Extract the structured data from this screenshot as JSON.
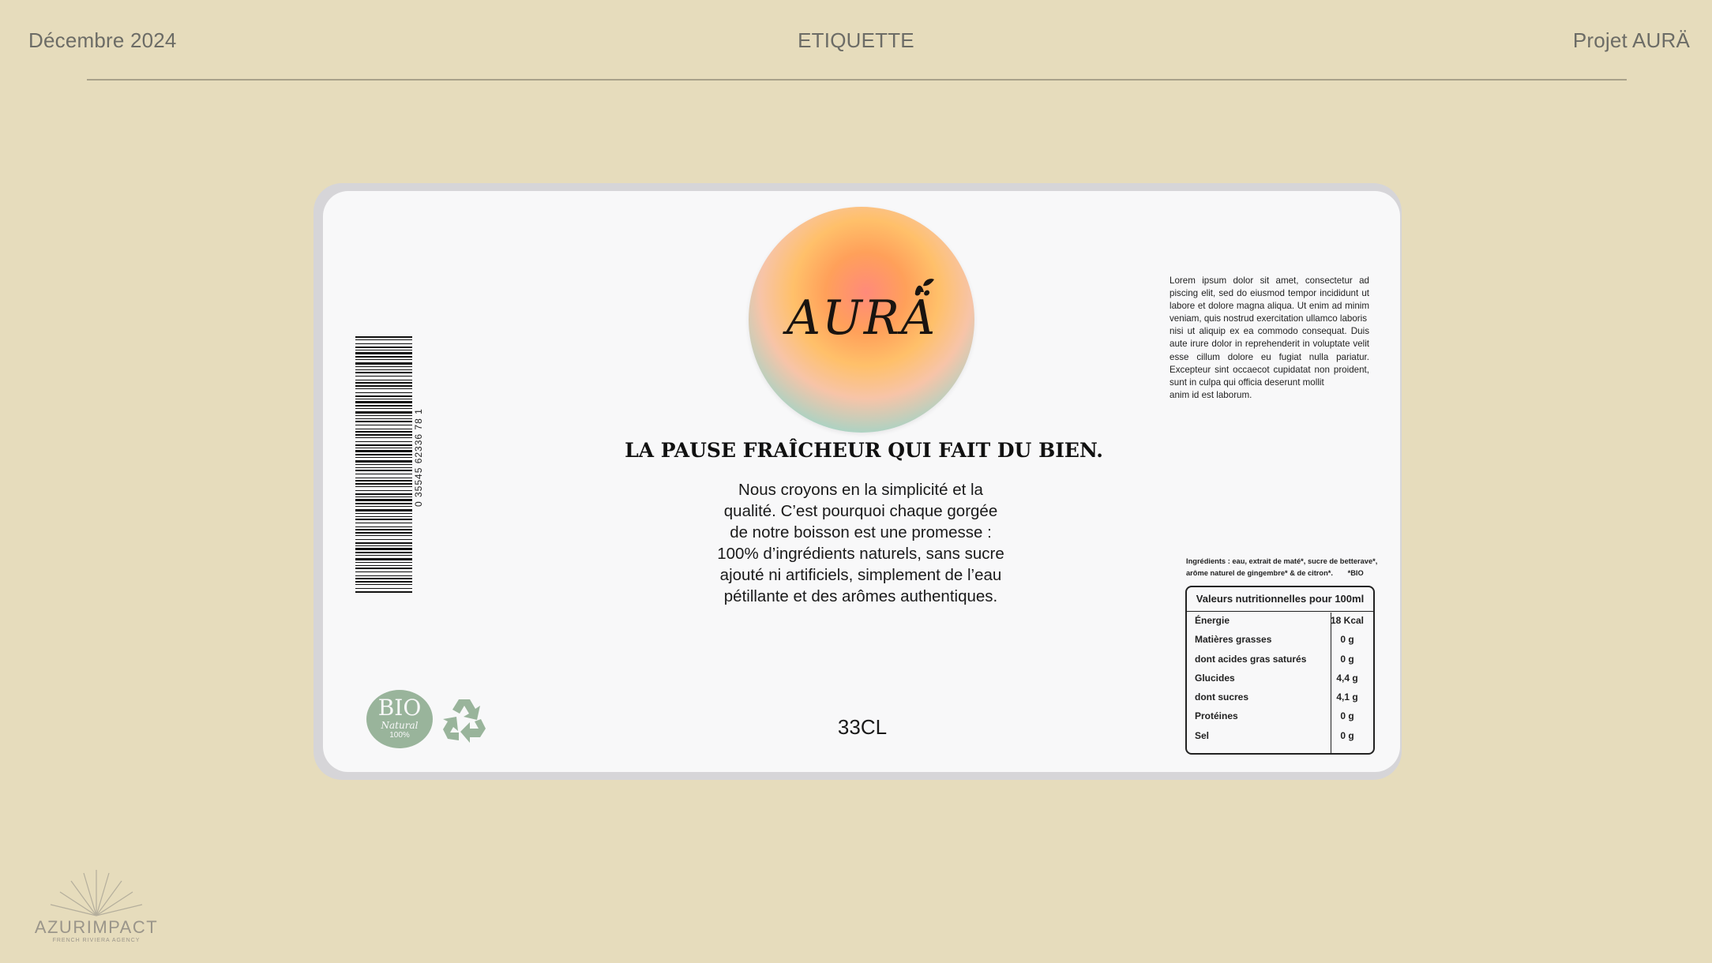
{
  "header": {
    "date": "Décembre 2024",
    "section": "ETIQUETTE",
    "project": "Projet AURÄ"
  },
  "label": {
    "brand": "AURÄ",
    "tagline": "LA PAUSE FRAÎCHEUR QUI FAIT DU BIEN.",
    "intro": "Nous croyons en la simplicité et la qualité. C’est pourquoi chaque gorgée de notre boisson est une promesse : 100% d’ingrédients naturels, sans sucre ajouté ni artificiels, simplement de l’eau pétillante et des arômes authentiques.",
    "volume": "33CL",
    "barcode_number": "0 35545 62336 78 1",
    "lorem": [
      "Lorem ipsum dolor sit amet, consectetur ad piscing elit, sed do eiusmod tempor incididunt ut labore et dolore magna aliqua. Ut enim ad minim veniam, quis nostrud exercitation ullamco laboris",
      "nisi ut aliquip ex ea commodo consequat. Duis aute irure dolor in reprehenderit in voluptate velit esse cillum dolore eu fugiat nulla pariatur. Excepteur sint occaecot cupidatat non proident, sunt in culpa qui officia deserunt mollit",
      "anim id est laborum."
    ],
    "ingredients": "Ingrédients : eau, extrait de maté*, sucre de betterave*, arôme naturel de gingembre* & de citron*.",
    "bio_note": "*BIO",
    "bio_badge": {
      "big": "BIO",
      "natural": "Natural",
      "pct": "100%"
    },
    "nutrition": {
      "title": "Valeurs nutritionnelles pour 100ml",
      "rows": [
        {
          "name": "Énergie",
          "value": "18 Kcal"
        },
        {
          "name": "Matières grasses",
          "value": "0 g"
        },
        {
          "name": "dont acides gras saturés",
          "value": "0 g"
        },
        {
          "name": "Glucides",
          "value": "4,4 g"
        },
        {
          "name": "dont sucres",
          "value": "4,1 g"
        },
        {
          "name": "Protéines",
          "value": "0 g"
        },
        {
          "name": "Sel",
          "value": "0 g"
        }
      ]
    }
  },
  "agency": {
    "name": "AZURIMPACT",
    "subtitle": "FRENCH RIVIERA AGENCY"
  },
  "colors": {
    "background": "#e6dcbc",
    "label": "#f8f8f9",
    "bio_green": "#99b49b"
  }
}
